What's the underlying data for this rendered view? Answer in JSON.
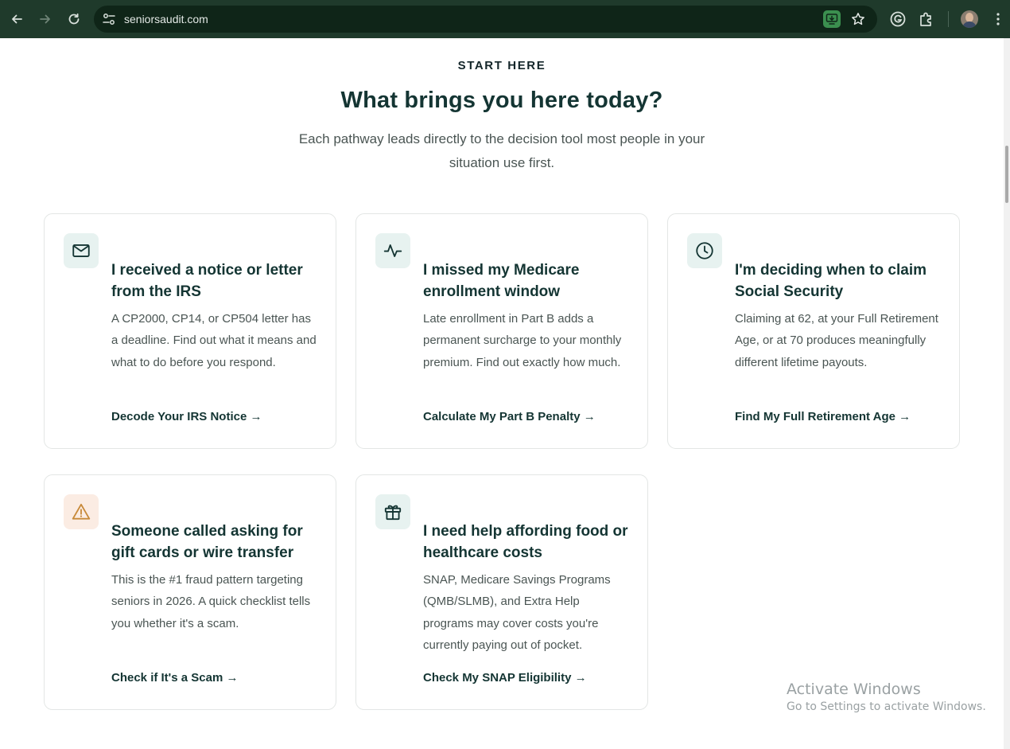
{
  "browser": {
    "url": "seniorsaudit.com",
    "icons": {
      "back": "arrow-left-icon",
      "forward": "arrow-right-icon",
      "reload": "reload-icon",
      "site_settings": "tune-icon",
      "install": "install-app-icon",
      "bookmark": "star-icon",
      "grammarly": "grammarly-icon",
      "extensions": "puzzle-icon",
      "profile": "avatar",
      "menu": "kebab-menu-icon"
    }
  },
  "section": {
    "eyebrow": "START HERE",
    "title": "What brings you here today?",
    "subtitle": "Each pathway leads directly to the decision tool most people in your situation use first."
  },
  "cards": [
    {
      "icon": "envelope-icon",
      "title": "I received a notice or letter from the IRS",
      "description": "A CP2000, CP14, or CP504 letter has a deadline. Find out what it means and what to do before you respond.",
      "link": "Decode Your IRS Notice →"
    },
    {
      "icon": "pulse-icon",
      "title": "I missed my Medicare enrollment window",
      "description": "Late enrollment in Part B adds a permanent surcharge to your monthly premium. Find out exactly how much.",
      "link": "Calculate My Part B Penalty →"
    },
    {
      "icon": "clock-icon",
      "title": "I'm deciding when to claim Social Security",
      "description": "Claiming at 62, at your Full Retirement Age, or at 70 produces meaningfully different lifetime payouts.",
      "link": "Find My Full Retirement Age →"
    },
    {
      "icon": "warning-icon",
      "title": "Someone called asking for gift cards or wire transfer",
      "description": "This is the #1 fraud pattern targeting seniors in 2026. A quick checklist tells you whether it's a scam.",
      "link": "Check if It's a Scam →"
    },
    {
      "icon": "gift-icon",
      "title": "I need help affording food or healthcare costs",
      "description": "SNAP, Medicare Savings Programs (QMB/SLMB), and Extra Help programs may cover costs you're currently paying out of pocket.",
      "link": "Check My SNAP Eligibility →"
    }
  ],
  "watermark": {
    "title": "Activate Windows",
    "subtitle": "Go to Settings to activate Windows."
  },
  "colors": {
    "chrome_bg": "#1f3a2b",
    "heading": "#143533",
    "icon_tile": "#e7f2f0",
    "warn_tile": "#fbece3",
    "warn_stroke": "#c88a3a"
  }
}
